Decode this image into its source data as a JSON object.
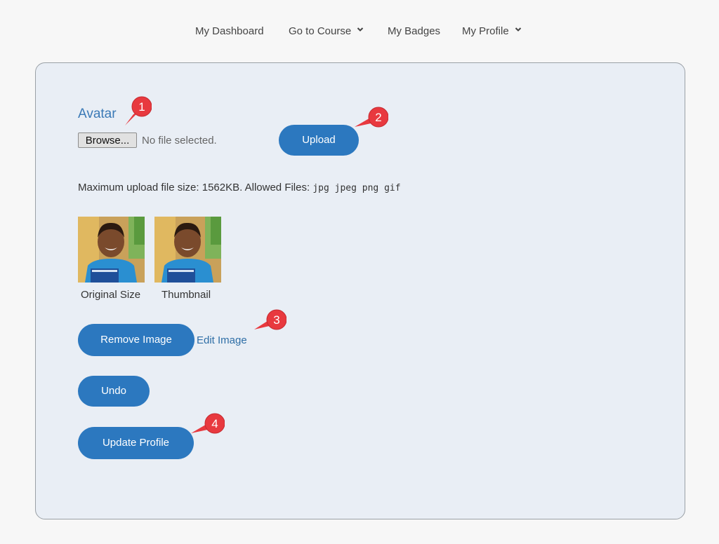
{
  "nav": {
    "items": [
      {
        "label": "My Dashboard"
      },
      {
        "label": "Go to Course",
        "has_dropdown": true
      },
      {
        "label": "My Badges"
      },
      {
        "label": "My Profile",
        "has_dropdown": true
      }
    ]
  },
  "form": {
    "avatar_label": "Avatar",
    "browse_label": "Browse...",
    "no_file_text": "No file selected.",
    "upload_label": "Upload",
    "max_upload_text": "Maximum upload file size: 1562KB. Allowed Files:",
    "allowed_files": "jpg jpeg png gif",
    "image_captions": {
      "original": "Original Size",
      "thumbnail": "Thumbnail"
    },
    "remove_label": "Remove Image",
    "edit_label": "Edit Image",
    "undo_label": "Undo",
    "update_label": "Update Profile"
  },
  "callouts": [
    "1",
    "2",
    "3",
    "4"
  ],
  "colors": {
    "primary_button": "#2c78bf",
    "link": "#2e6ea6",
    "callout": "#e8393f",
    "card_bg": "#e9eef5"
  }
}
